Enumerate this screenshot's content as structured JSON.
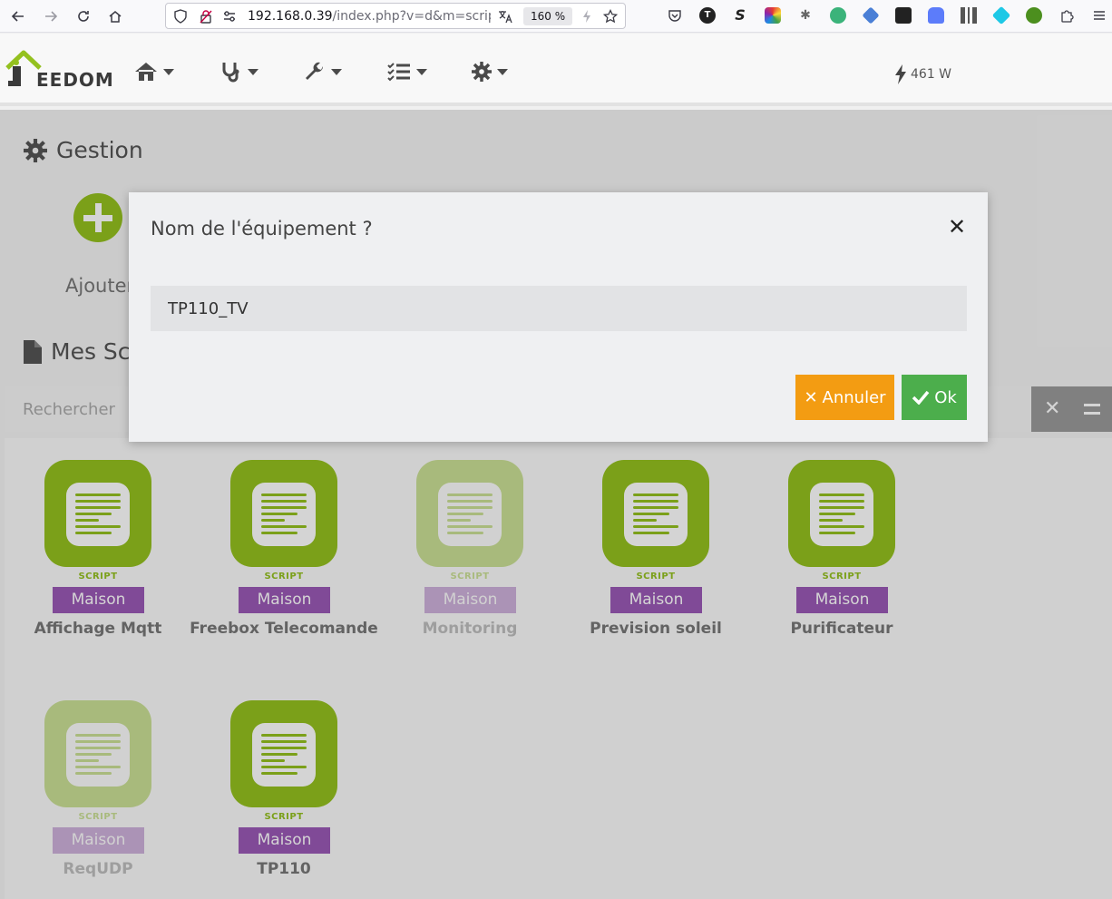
{
  "browser": {
    "url": "192.168.0.39",
    "url_rest": "/index.php?v=d&m=script",
    "zoom": "160 %"
  },
  "header": {
    "logo_text": "EEDOM",
    "power": "461 W"
  },
  "gestion": {
    "title": "Gestion",
    "add_label": "Ajouter"
  },
  "scripts_section": {
    "title": "Mes Scripts",
    "search_placeholder": "Rechercher"
  },
  "cards": [
    {
      "type": "SCRIPT",
      "badge": "Maison",
      "name": "Affichage Mqtt",
      "enabled": true
    },
    {
      "type": "SCRIPT",
      "badge": "Maison",
      "name": "Freebox Telecomande",
      "enabled": true
    },
    {
      "type": "SCRIPT",
      "badge": "Maison",
      "name": "Monitoring",
      "enabled": false
    },
    {
      "type": "SCRIPT",
      "badge": "Maison",
      "name": "Prevision soleil",
      "enabled": true
    },
    {
      "type": "SCRIPT",
      "badge": "Maison",
      "name": "Purificateur",
      "enabled": true
    },
    {
      "type": "SCRIPT",
      "badge": "Maison",
      "name": "ReqUDP",
      "enabled": false
    },
    {
      "type": "SCRIPT",
      "badge": "Maison",
      "name": "TP110",
      "enabled": true
    }
  ],
  "modal": {
    "title": "Nom de l'équipement ?",
    "input_value": "TP110_TV",
    "cancel_label": "Annuler",
    "ok_label": "Ok"
  },
  "colors": {
    "accent_green": "#94c11f",
    "badge_purple": "#9b59b6",
    "cancel_orange": "#f39c12",
    "ok_green": "#4cae4c"
  }
}
